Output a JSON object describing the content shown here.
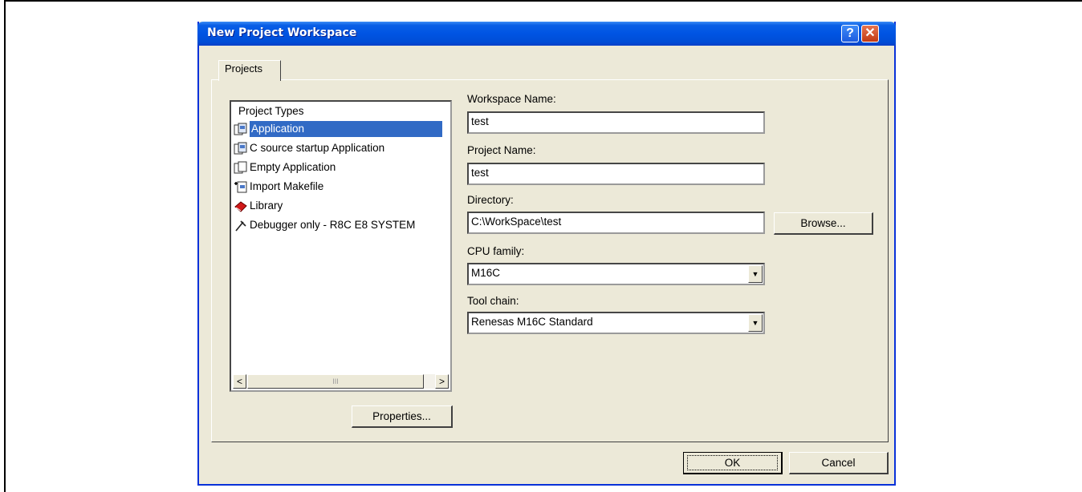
{
  "dialog": {
    "title": "New Project Workspace",
    "help_symbol": "?",
    "close_symbol": "✕"
  },
  "tab": {
    "label": "Projects"
  },
  "project_types": {
    "header": "Project Types",
    "items": [
      {
        "label": "Application",
        "selected": true,
        "icon": "application-icon"
      },
      {
        "label": "C source startup Application",
        "icon": "application-icon"
      },
      {
        "label": "Empty Application",
        "icon": "empty-application-icon"
      },
      {
        "label": "Import Makefile",
        "icon": "import-makefile-icon"
      },
      {
        "label": "Library",
        "icon": "library-icon"
      },
      {
        "label": "Debugger only - R8C E8 SYSTEM",
        "icon": "debugger-icon"
      }
    ],
    "scroll_left": "<",
    "scroll_right": ">",
    "thumb_grip": "III"
  },
  "buttons": {
    "properties": "Properties...",
    "browse": "Browse...",
    "ok": "OK",
    "cancel": "Cancel"
  },
  "fields": {
    "workspace_name": {
      "label": "Workspace Name:",
      "value": "test"
    },
    "project_name": {
      "label": "Project Name:",
      "value": "test"
    },
    "directory": {
      "label": "Directory:",
      "value": "C:\\WorkSpace\\test"
    },
    "cpu_family": {
      "label": "CPU family:",
      "value": "M16C"
    },
    "tool_chain": {
      "label": "Tool chain:",
      "value": "Renesas M16C Standard"
    }
  },
  "colors": {
    "selection": "#316ac5",
    "titlebar": "#0054e3",
    "dialog_bg": "#ece9d8"
  }
}
